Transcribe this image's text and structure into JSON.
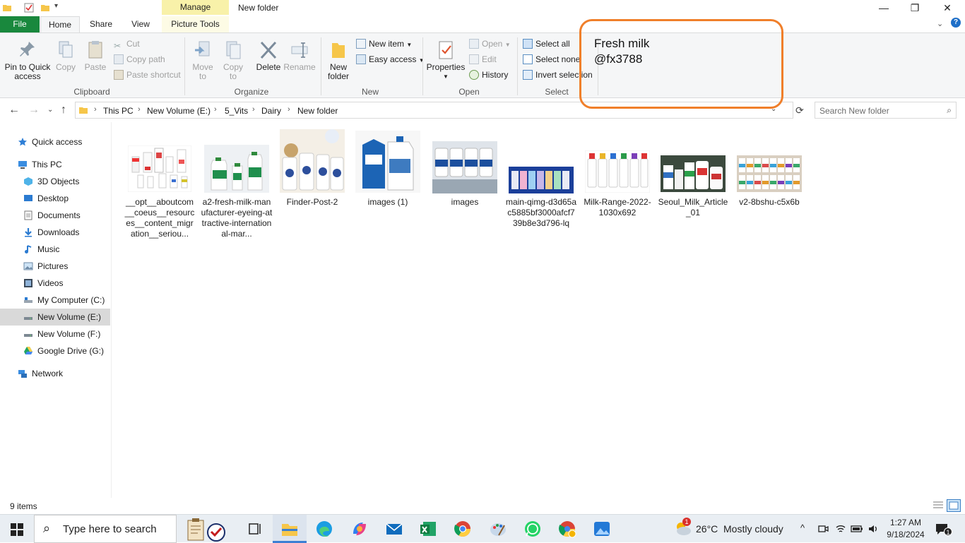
{
  "window": {
    "manage_tab": "Manage",
    "title": "New folder",
    "minimize_glyph": "—",
    "restore_glyph": "❐",
    "close_glyph": "✕"
  },
  "tabs": {
    "file": "File",
    "home": "Home",
    "share": "Share",
    "view": "View",
    "picture_tools": "Picture Tools"
  },
  "ribbon": {
    "pin_to_quick_access": "Pin to Quick access",
    "copy": "Copy",
    "paste": "Paste",
    "cut": "Cut",
    "copy_path": "Copy path",
    "paste_shortcut": "Paste shortcut",
    "clipboard_group": "Clipboard",
    "move_to": "Move to",
    "copy_to": "Copy to",
    "delete": "Delete",
    "rename": "Rename",
    "organize_group": "Organize",
    "new_folder": "New folder",
    "new_item": "New item",
    "easy_access": "Easy access",
    "new_group": "New",
    "properties": "Properties",
    "open": "Open",
    "edit": "Edit",
    "history": "History",
    "open_group": "Open",
    "select_all": "Select all",
    "select_none": "Select none",
    "invert_selection": "Invert selection",
    "select_group": "Select"
  },
  "annotation": {
    "line1": "Fresh milk",
    "line2": "@fx3788",
    "border_color": "#f07f2a"
  },
  "address": {
    "crumbs": [
      "This PC",
      "New Volume (E:)",
      "5_Vits",
      "Dairy",
      "New folder"
    ],
    "search_placeholder": "Search New folder"
  },
  "sidebar": {
    "items": [
      {
        "label": "Quick access",
        "icon": "star-icon"
      },
      {
        "label": "This PC",
        "icon": "computer-icon"
      },
      {
        "label": "3D Objects",
        "icon": "cube-icon"
      },
      {
        "label": "Desktop",
        "icon": "desktop-icon"
      },
      {
        "label": "Documents",
        "icon": "document-icon"
      },
      {
        "label": "Downloads",
        "icon": "download-icon"
      },
      {
        "label": "Music",
        "icon": "music-icon"
      },
      {
        "label": "Pictures",
        "icon": "pictures-icon"
      },
      {
        "label": "Videos",
        "icon": "video-icon"
      },
      {
        "label": "My Computer (C:)",
        "icon": "drive-c-icon"
      },
      {
        "label": "New Volume (E:)",
        "icon": "drive-icon"
      },
      {
        "label": "New Volume (F:)",
        "icon": "drive-icon"
      },
      {
        "label": "Google Drive (G:)",
        "icon": "google-drive-icon"
      },
      {
        "label": "Network",
        "icon": "network-icon"
      }
    ]
  },
  "files": [
    {
      "name": "__opt__aboutcom__coeus__resources__content_migration__seriou..."
    },
    {
      "name": "a2-fresh-milk-manufacturer-eyeing-attractive-international-mar..."
    },
    {
      "name": "Finder-Post-2"
    },
    {
      "name": "images (1)"
    },
    {
      "name": "images"
    },
    {
      "name": "main-qimg-d3d65ac5885bf3000afcf739b8e3d796-lq"
    },
    {
      "name": "Milk-Range-2022-1030x692"
    },
    {
      "name": "Seoul_Milk_Article_01"
    },
    {
      "name": "v2-8bshu-c5x6b"
    }
  ],
  "status": {
    "item_count": "9 items"
  },
  "taskbar": {
    "search_placeholder": "Type here to search",
    "weather_temp": "26°C",
    "weather_desc": "Mostly cloudy",
    "time": "1:27 AM",
    "date": "9/18/2024",
    "notification_count": "1",
    "weather_badge": "1"
  }
}
